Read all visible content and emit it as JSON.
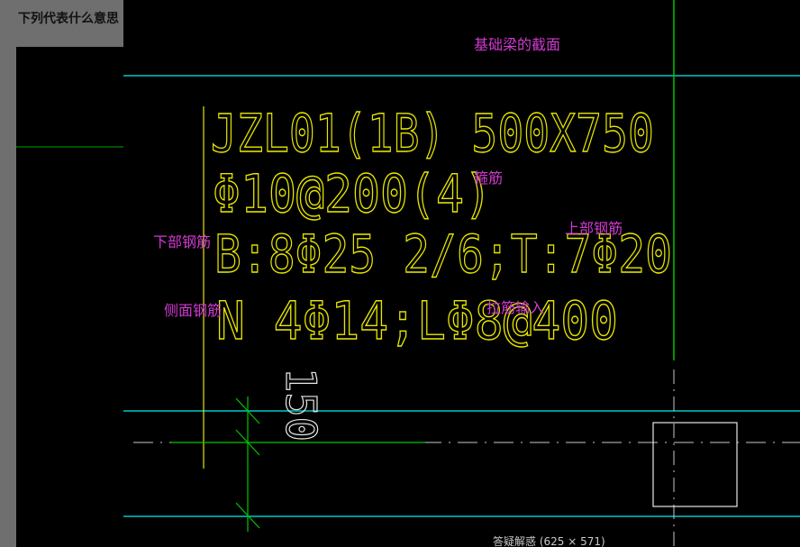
{
  "page": {
    "question": "下列代表什么意思"
  },
  "cad": {
    "line1": "JZL01(1B) 500X750",
    "line2": "Φ10@200(4)",
    "line3": "B:8Φ25  2/6;T:7Φ20",
    "line4": "N 4Φ14;LΦ8@400",
    "dimension": "150"
  },
  "annotations": {
    "title": "基础梁的截面",
    "stirrup": "箍筋",
    "top_bars": "上部钢筋",
    "bottom_bars": "下部钢筋",
    "side_bars": "侧面钢筋",
    "tie_bars": "拉筋输入"
  },
  "viewer": {
    "caption": "答疑解惑 (625 × 571)"
  },
  "colors": {
    "cad_text": "#e6e600",
    "cyan_line": "#00c8c8",
    "green_line": "#00c800",
    "annotation": "#d23ad2",
    "grey_bg": "#6f6f6f"
  }
}
